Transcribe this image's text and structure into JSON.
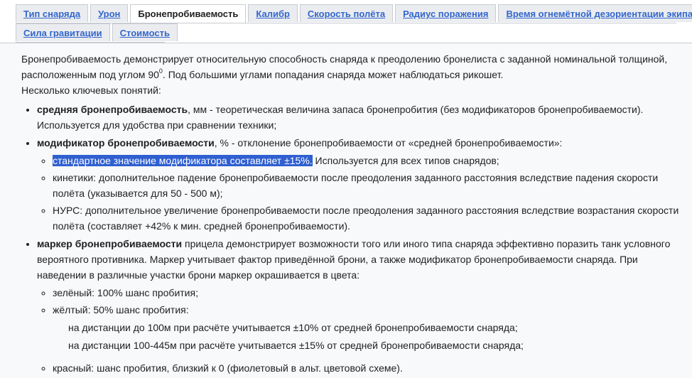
{
  "tabs": {
    "row1": [
      {
        "label": "Тип снаряда",
        "active": false
      },
      {
        "label": "Урон",
        "active": false
      },
      {
        "label": "Бронепробиваемость",
        "active": true
      },
      {
        "label": "Калибр",
        "active": false
      },
      {
        "label": "Скорость полёта",
        "active": false
      },
      {
        "label": "Радиус поражения",
        "active": false
      },
      {
        "label": "Время огнемётной дезориентации экипажа",
        "active": false
      }
    ],
    "row2": [
      {
        "label": "Сила гравитации",
        "active": false
      },
      {
        "label": "Стоимость",
        "active": false
      }
    ]
  },
  "intro": {
    "text_before_sup": "Бронепробиваемость демонстрирует относительную способность снаряда к преодолению бронелиста с заданной номинальной толщиной, расположенным под углом 90",
    "sup": "0",
    "text_after_sup": ". Под большими углами попадания снаряда может наблюдаться рикошет.",
    "key_concepts": "Несколько ключевых понятий:"
  },
  "list": {
    "item1": {
      "term": "средняя бронепробиваемость",
      "text": ", мм - теоретическая величина запаса бронепробития (без модификаторов бронепробиваемости). Используется для удобства при сравнении техники;"
    },
    "item2": {
      "term": "модификатор бронепробиваемости",
      "text": ", % - отклонение бронепробиваемости от «средней бронепробиваемости»:",
      "sub": {
        "s1_highlight": "стандартное значение модификатора составляет ±15%.",
        "s1_rest": " Используется для всех типов снарядов;",
        "s2": "кинетики: дополнительное падение бронепробиваемости после преодоления заданного расстояния вследствие падения скорости полёта (указывается для 50 - 500 м);",
        "s3": "НУРС: дополнительное увеличение бронепробиваемости после преодоления заданного расстояния вследствие возрастания скорости полёта (составляет +42% к мин. средней бронепробиваемости)."
      }
    },
    "item3": {
      "term": "маркер бронепробиваемости",
      "text": " прицела демонстрирует возможности того или иного типа снаряда эффективно поразить танк условного вероятного противника. Маркер учитывает фактор приведённой брони, а также модификатор бронепробиваемости снаряда. При наведении в различные участки брони маркер окрашивается в цвета:",
      "sub": {
        "green": "зелёный: 100% шанс пробития;",
        "yellow": "жёлтый: 50% шанс пробития:",
        "yellow_line1": "на дистанции до 100м при расчёте учитывается ±10% от средней бронепробиваемости снаряда;",
        "yellow_line2": "на дистанции 100-445м при расчёте учитывается ±15% от средней бронепробиваемости снаряда;",
        "red": "красный: шанс пробития, близкий к 0 (фиолетовый в альт. цветовой схеме)."
      }
    }
  },
  "colors": {
    "tab_link": "#3366cc",
    "highlight_bg": "#2f5fd0",
    "content_bg": "#f8f9fa"
  }
}
